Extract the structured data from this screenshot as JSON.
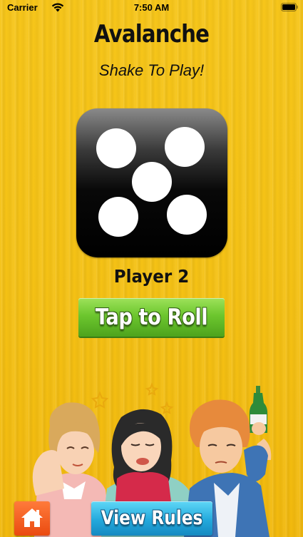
{
  "status_bar": {
    "carrier": "Carrier",
    "time": "7:50 AM",
    "wifi_icon": "wifi-icon",
    "battery_icon": "battery-icon"
  },
  "header": {
    "title": "Avalanche",
    "subtitle": "Shake To Play!"
  },
  "dice": {
    "value": 5,
    "icon": "dice-five-icon"
  },
  "game": {
    "current_player": "Player 2",
    "roll_button_label": "Tap to Roll"
  },
  "footer": {
    "home_icon": "home-icon",
    "rules_button_label": "View Rules"
  },
  "colors": {
    "background": "#f5c215",
    "roll_button": "#6cc62e",
    "home_button": "#ea4a10",
    "rules_button": "#23a9dc",
    "dice": "#000000"
  }
}
